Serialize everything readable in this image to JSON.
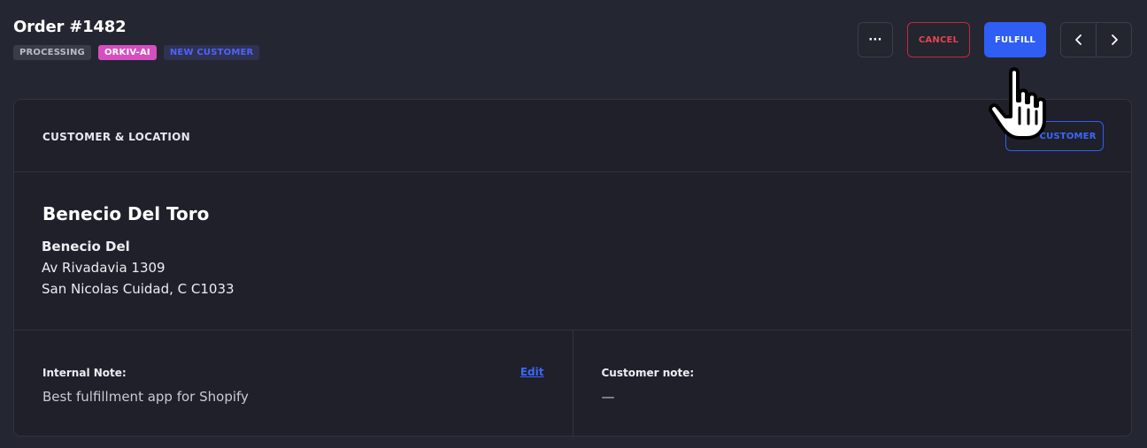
{
  "order": {
    "title": "Order #1482",
    "badges": [
      "PROCESSING",
      "ORKIV-AI",
      "NEW CUSTOMER"
    ]
  },
  "toolbar": {
    "more_label": "···",
    "cancel_label": "CANCEL",
    "fulfill_label": "FULFILL",
    "prev_icon": "chevron-left-icon",
    "next_icon": "chevron-right-icon"
  },
  "card": {
    "title": "CUSTOMER & LOCATION",
    "edit_customer_label": "EDIT CUSTOMER"
  },
  "customer": {
    "name": "Benecio Del Toro",
    "address_lines": [
      "Benecio Del",
      "Av Rivadavia 1309",
      "San Nicolas Cuidad, C C1033"
    ]
  },
  "notes": {
    "internal": {
      "label": "Internal Note:",
      "edit_label": "Edit",
      "value": "Best fulfillment app for Shopify"
    },
    "customer": {
      "label": "Customer note:",
      "value": "—"
    }
  },
  "colors": {
    "background": "#242632",
    "card": "#1f2029",
    "accent": "#2f5ef5",
    "danger": "#c32a3c",
    "ai_badge": "#d44fbf"
  }
}
